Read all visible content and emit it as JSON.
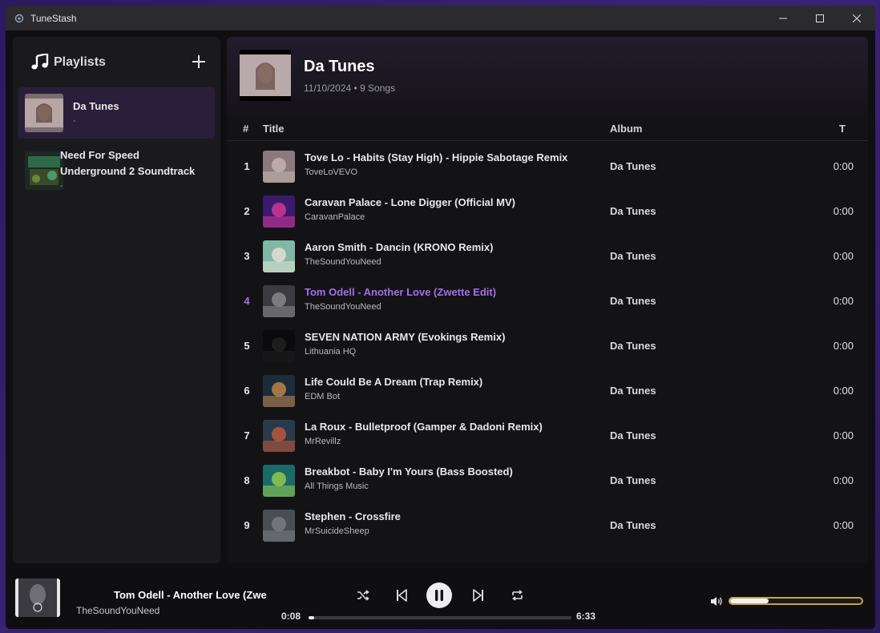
{
  "app": {
    "title": "TuneStash"
  },
  "sidebar": {
    "title": "Playlists",
    "items": [
      {
        "name": "Da Tunes",
        "sub": "-",
        "active": true
      },
      {
        "name_line1": "Need For Speed",
        "name_line2": "Underground 2 Soundtrack",
        "sub": "-"
      }
    ]
  },
  "playlist": {
    "title": "Da Tunes",
    "meta": "11/10/2024 • 9 Songs",
    "columns": {
      "num": "#",
      "title": "Title",
      "album": "Album",
      "time": "T"
    },
    "tracks": [
      {
        "num": "1",
        "title": "Tove Lo - Habits (Stay High) - Hippie Sabotage Remix",
        "artist": "ToveLoVEVO",
        "album": "Da Tunes",
        "duration": "0:00",
        "thumb_colors": [
          "#8a7a7e",
          "#c9b7b3"
        ]
      },
      {
        "num": "2",
        "title": "Caravan Palace - Lone Digger (Official MV)",
        "artist": "CaravanPalace",
        "album": "Da Tunes",
        "duration": "0:00",
        "thumb_colors": [
          "#3b1a6e",
          "#d63a9a"
        ]
      },
      {
        "num": "3",
        "title": "Aaron Smith - Dancin (KRONO Remix)",
        "artist": "TheSoundYouNeed",
        "album": "Da Tunes",
        "duration": "0:00",
        "thumb_colors": [
          "#7fb8a4",
          "#e8e2d6"
        ]
      },
      {
        "num": "4",
        "title": "Tom Odell - Another Love (Zwette Edit)",
        "artist": "TheSoundYouNeed",
        "album": "Da Tunes",
        "duration": "0:00",
        "playing": true,
        "thumb_colors": [
          "#3a3a40",
          "#8c8c90"
        ]
      },
      {
        "num": "5",
        "title": "SEVEN NATION ARMY (Evokings Remix)",
        "artist": "Lithuania HQ",
        "album": "Da Tunes",
        "duration": "0:00",
        "thumb_colors": [
          "#0b0b0b",
          "#222222"
        ]
      },
      {
        "num": "6",
        "title": "Life Could Be A Dream (Trap Remix)",
        "artist": "EDM Bot",
        "album": "Da Tunes",
        "duration": "0:00",
        "thumb_colors": [
          "#1e2b3a",
          "#c48a4a"
        ]
      },
      {
        "num": "7",
        "title": "La Roux - Bulletproof (Gamper & Dadoni Remix)",
        "artist": "MrRevillz",
        "album": "Da Tunes",
        "duration": "0:00",
        "thumb_colors": [
          "#2a3a4a",
          "#c45a3a"
        ]
      },
      {
        "num": "8",
        "title": "Breakbot - Baby I'm Yours (Bass Boosted)",
        "artist": "All Things Music",
        "album": "Da Tunes",
        "duration": "0:00",
        "thumb_colors": [
          "#1a6a6a",
          "#9ad04a"
        ]
      },
      {
        "num": "9",
        "title": "Stephen - Crossfire",
        "artist": "MrSuicideSheep",
        "album": "Da Tunes",
        "duration": "0:00",
        "thumb_colors": [
          "#4a4e52",
          "#7a7e82"
        ]
      }
    ]
  },
  "player": {
    "title": "Tom Odell - Another Love (Zwe",
    "artist": "TheSoundYouNeed",
    "elapsed": "0:08",
    "total": "6:33",
    "progress_fraction": 0.02,
    "volume_fraction": 0.29
  },
  "colors": {
    "accent": "#a46ee8",
    "volume_border": "#c9a24a"
  }
}
